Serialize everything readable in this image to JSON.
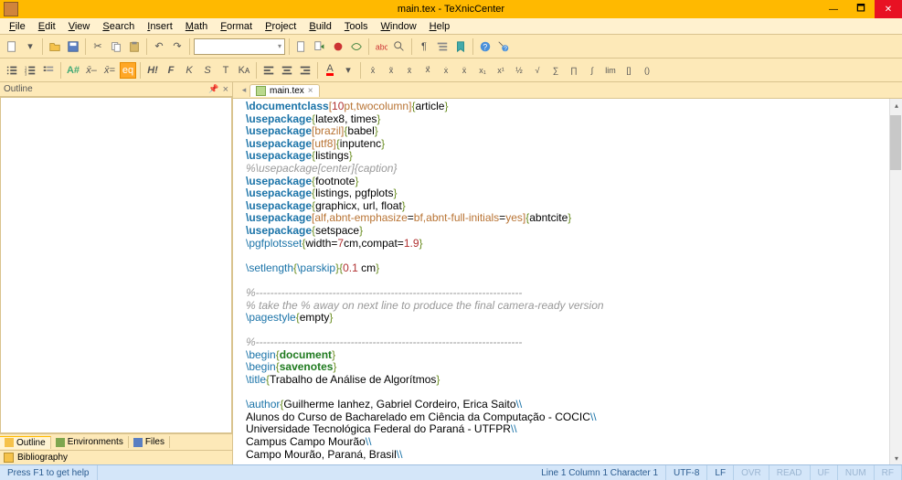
{
  "title": "main.tex - TeXnicCenter",
  "menu": [
    "File",
    "Edit",
    "View",
    "Search",
    "Insert",
    "Math",
    "Format",
    "Project",
    "Build",
    "Tools",
    "Window",
    "Help"
  ],
  "sidepanel": {
    "title": "Outline",
    "tabs": [
      "Outline",
      "Environments",
      "Files"
    ],
    "biblio": "Bibliography"
  },
  "editor": {
    "tab": "main.tex",
    "lines": [
      [
        [
          "cmd",
          "\\documentclass"
        ],
        [
          "opt",
          "["
        ],
        [
          "num",
          "10"
        ],
        [
          "opt",
          "pt,twocolumn]"
        ],
        [
          "br",
          "{"
        ],
        [
          "txt",
          "article"
        ],
        [
          "br",
          "}"
        ]
      ],
      [
        [
          "cmd",
          "\\usepackage"
        ],
        [
          "br",
          "{"
        ],
        [
          "txt",
          "latex8, times"
        ],
        [
          "br",
          "}"
        ]
      ],
      [
        [
          "cmd",
          "\\usepackage"
        ],
        [
          "opt",
          "[brazil]"
        ],
        [
          "br",
          "{"
        ],
        [
          "txt",
          "babel"
        ],
        [
          "br",
          "}"
        ]
      ],
      [
        [
          "cmd",
          "\\usepackage"
        ],
        [
          "opt",
          "[utf8]"
        ],
        [
          "br",
          "{"
        ],
        [
          "txt",
          "inputenc"
        ],
        [
          "br",
          "}"
        ]
      ],
      [
        [
          "cmd",
          "\\usepackage"
        ],
        [
          "br",
          "{"
        ],
        [
          "txt",
          "listings"
        ],
        [
          "br",
          "}"
        ]
      ],
      [
        [
          "comment",
          "%\\usepackage[center]{caption}"
        ]
      ],
      [
        [
          "cmd",
          "\\usepackage"
        ],
        [
          "br",
          "{"
        ],
        [
          "txt",
          "footnote"
        ],
        [
          "br",
          "}"
        ]
      ],
      [
        [
          "cmd",
          "\\usepackage"
        ],
        [
          "br",
          "{"
        ],
        [
          "txt",
          "listings, pgfplots"
        ],
        [
          "br",
          "}"
        ]
      ],
      [
        [
          "cmd",
          "\\usepackage"
        ],
        [
          "br",
          "{"
        ],
        [
          "txt",
          "graphicx, url, float"
        ],
        [
          "br",
          "}"
        ]
      ],
      [
        [
          "cmd",
          "\\usepackage"
        ],
        [
          "opt",
          "[alf,abnt-emphasize"
        ],
        [
          "txt",
          "="
        ],
        [
          "opt",
          "bf,abnt-full-initials"
        ],
        [
          "txt",
          "="
        ],
        [
          "opt",
          "yes]"
        ],
        [
          "br",
          "{"
        ],
        [
          "txt",
          "abntcite"
        ],
        [
          "br",
          "}"
        ]
      ],
      [
        [
          "cmd",
          "\\usepackage"
        ],
        [
          "br",
          "{"
        ],
        [
          "txt",
          "setspace"
        ],
        [
          "br",
          "}"
        ]
      ],
      [
        [
          "cmd2",
          "\\pgfplotsset"
        ],
        [
          "br",
          "{"
        ],
        [
          "txt",
          "width"
        ],
        [
          "txt",
          "="
        ],
        [
          "num",
          "7"
        ],
        [
          "txt",
          "cm,compat"
        ],
        [
          "txt",
          "="
        ],
        [
          "num",
          "1.9"
        ],
        [
          "br",
          "}"
        ]
      ],
      [
        [
          "txt",
          ""
        ]
      ],
      [
        [
          "cmd2",
          "\\setlength"
        ],
        [
          "br",
          "{"
        ],
        [
          "cmd2",
          "\\parskip"
        ],
        [
          "br",
          "}{"
        ],
        [
          "num",
          "0.1"
        ],
        [
          "txt",
          " cm"
        ],
        [
          "br",
          "}"
        ]
      ],
      [
        [
          "txt",
          ""
        ]
      ],
      [
        [
          "comment",
          "%------------------------------------------------------------------------- "
        ]
      ],
      [
        [
          "comment",
          "% take the % away on next line to produce the final camera-ready version"
        ]
      ],
      [
        [
          "cmd2",
          "\\pagestyle"
        ],
        [
          "br",
          "{"
        ],
        [
          "txt",
          "empty"
        ],
        [
          "br",
          "}"
        ]
      ],
      [
        [
          "txt",
          ""
        ]
      ],
      [
        [
          "comment",
          "%------------------------------------------------------------------------- "
        ]
      ],
      [
        [
          "cmd2",
          "\\begin"
        ],
        [
          "br",
          "{"
        ],
        [
          "kw",
          "document"
        ],
        [
          "br",
          "}"
        ]
      ],
      [
        [
          "cmd2",
          "\\begin"
        ],
        [
          "br",
          "{"
        ],
        [
          "kw",
          "savenotes"
        ],
        [
          "br",
          "}"
        ]
      ],
      [
        [
          "cmd2",
          "\\title"
        ],
        [
          "br",
          "{"
        ],
        [
          "txt",
          "Trabalho de Análise de Algorítmos"
        ],
        [
          "br",
          "}"
        ]
      ],
      [
        [
          "txt",
          ""
        ]
      ],
      [
        [
          "cmd2",
          "\\author"
        ],
        [
          "br",
          "{"
        ],
        [
          "txt",
          "Guilherme Ianhez, Gabriel Cordeiro, Erica Saito"
        ],
        [
          "cmd2",
          "\\\\"
        ]
      ],
      [
        [
          "txt",
          "Alunos do Curso de Bacharelado em Ciência da Computação - COCIC"
        ],
        [
          "cmd2",
          "\\\\"
        ]
      ],
      [
        [
          "txt",
          "Universidade Tecnológica Federal do Paraná - UTFPR"
        ],
        [
          "cmd2",
          "\\\\"
        ]
      ],
      [
        [
          "txt",
          "Campus Campo Mourão"
        ],
        [
          "cmd2",
          "\\\\"
        ]
      ],
      [
        [
          "txt",
          "Campo Mourão, Paraná, Brasil"
        ],
        [
          "cmd2",
          "\\\\"
        ]
      ]
    ]
  },
  "status": {
    "help": "Press F1 to get help",
    "pos": "Line 1 Column 1 Character 1",
    "enc": "UTF-8",
    "eol": "LF",
    "flags": [
      "OVR",
      "READ",
      "UF",
      "NUM",
      "RF"
    ]
  }
}
